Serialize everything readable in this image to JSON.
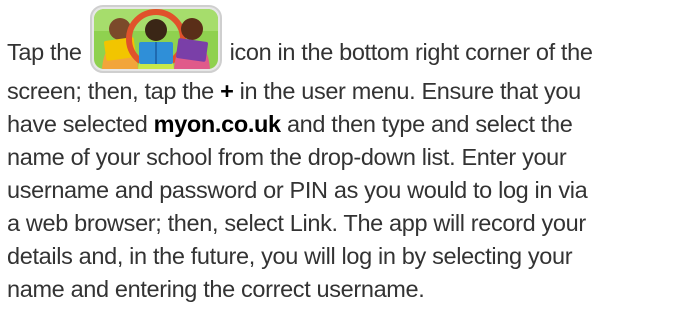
{
  "instructions": {
    "line1_before_icon": "Tap the",
    "line1_after_icon": "icon in the bottom right corner of the",
    "line2_before_plus": "screen; then, tap the",
    "plus_symbol": "+",
    "line2_after_plus": "in the user menu. Ensure that you",
    "line3_before_domain": "have selected",
    "domain": "myon.co.uk",
    "line3_after_domain": "and then type and select the",
    "line4": "name of your school from the drop-down list. Enter your",
    "line5": "username and password or PIN as you would to log in via",
    "line6": "a web browser; then, select Link. The app will record your",
    "line7": "details and, in the future, you will log in by selecting your",
    "line8": "name and entering the correct username."
  },
  "icon": {
    "name": "readers-icon",
    "colors": {
      "background": "#8fd14f",
      "border": "#cfcfcf",
      "circle": "#e0522b",
      "book_left": "#f2c500",
      "book_center": "#2f8fd8",
      "book_right": "#7a3fa8"
    }
  }
}
